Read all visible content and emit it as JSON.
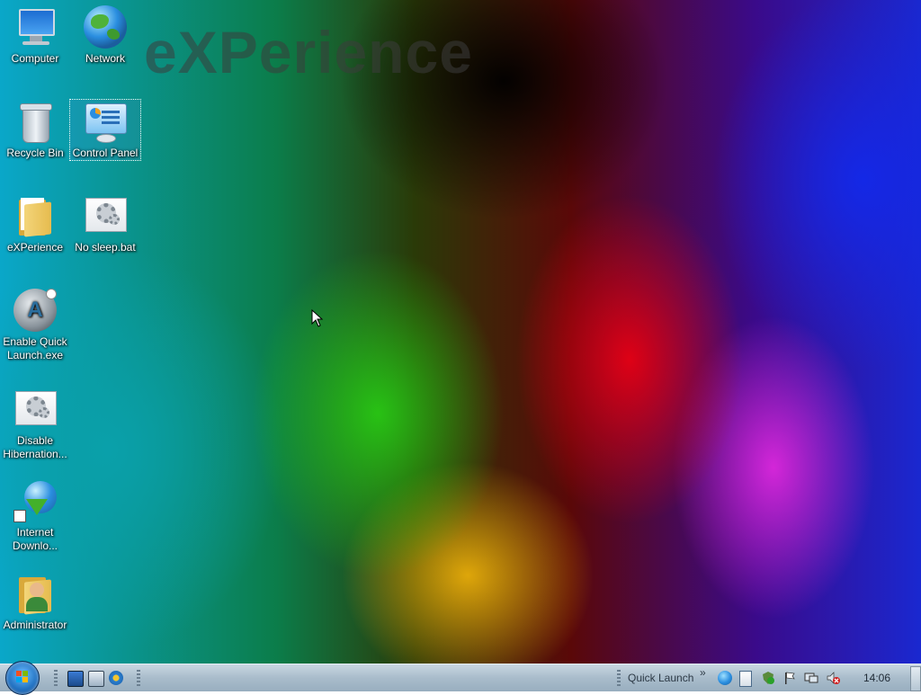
{
  "desktop": {
    "watermark": "eXPerience",
    "icons": [
      {
        "label": "Computer"
      },
      {
        "label": "Network"
      },
      {
        "label": "Recycle Bin"
      },
      {
        "label": "Control Panel"
      },
      {
        "label": "eXPerience"
      },
      {
        "label": "No sleep.bat"
      },
      {
        "label": "Enable Quick Launch.exe"
      },
      {
        "label": "Disable Hibernation..."
      },
      {
        "label": "Internet Downlo..."
      },
      {
        "label": "Administrator"
      }
    ]
  },
  "taskbar": {
    "start_button": "start-orb",
    "quick_launch_icons": [
      "show-desktop-icon",
      "switch-windows-icon",
      "internet-explorer-icon"
    ],
    "quick_launch_label": "Quick Launch",
    "quick_launch_chevron": "»",
    "tray_icons": [
      "network-globe-icon",
      "notepad-icon",
      "security-shield-icon",
      "action-center-flag-icon",
      "network-monitor-icon",
      "volume-muted-icon"
    ],
    "clock": "14:06"
  },
  "colors": {
    "taskbar": "#a9bccb",
    "icon_text": "#ffffff",
    "start_orb": "#1f6fc0"
  }
}
